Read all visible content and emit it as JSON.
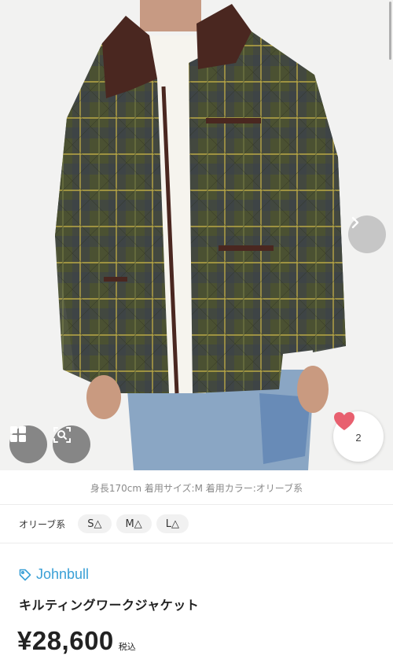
{
  "product": {
    "caption": "身長170cm 着用サイズ:M 着用カラー:オリーブ系",
    "favorite_count": "2",
    "brand": "Johnbull",
    "title": "キルティングワークジャケット",
    "price": "¥28,600",
    "tax_label": "税込"
  },
  "variants": {
    "color": "オリーブ系",
    "sizes": [
      "S△",
      "M△",
      "L△"
    ]
  },
  "colors": {
    "accent": "#3aa0d6",
    "heart": "#e8606f"
  },
  "icons": [
    "chevron-right-icon",
    "grid-icon",
    "image-search-icon",
    "heart-icon",
    "tag-icon"
  ]
}
